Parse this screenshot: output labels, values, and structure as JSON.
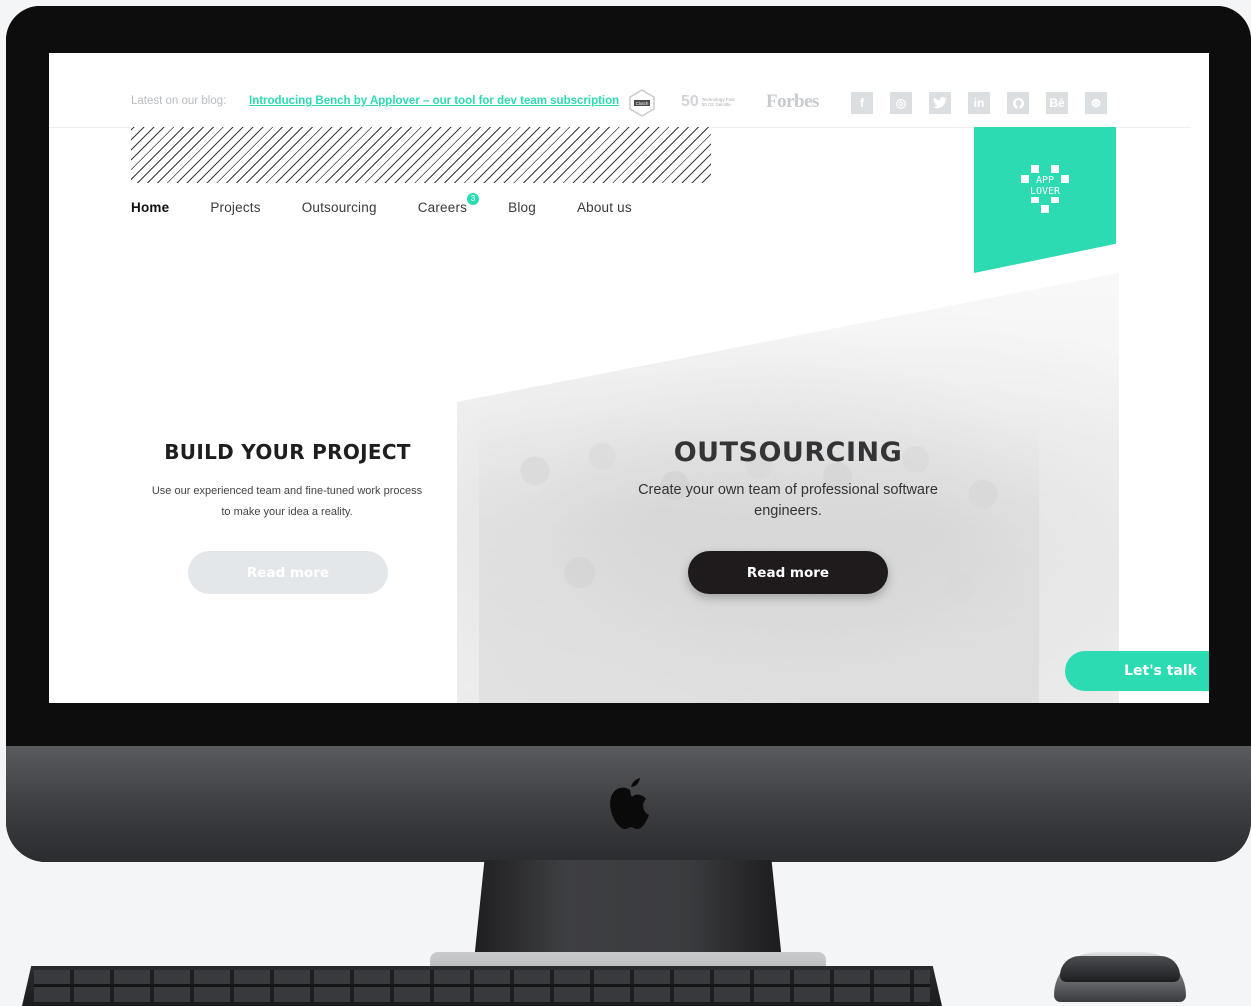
{
  "topbar": {
    "blog_label": "Latest on our blog:",
    "blog_link": "Introducing Bench by Applover – our tool for dev team subscription",
    "badges": {
      "clutch": "Clutch",
      "deloitte_number": "50",
      "deloitte_text": "Technology Fast 50 CE Deloitte",
      "forbes": "Forbes"
    },
    "socials": [
      {
        "icon": "facebook-icon",
        "glyph": "f"
      },
      {
        "icon": "instagram-icon",
        "glyph": "◎"
      },
      {
        "icon": "twitter-icon",
        "glyph": "🐦"
      },
      {
        "icon": "linkedin-icon",
        "glyph": "in"
      },
      {
        "icon": "github-icon",
        "glyph": "◉"
      },
      {
        "icon": "behance-icon",
        "glyph": "Bē"
      },
      {
        "icon": "dribbble-icon",
        "glyph": "⊛"
      }
    ]
  },
  "nav": {
    "items": [
      {
        "label": "Home",
        "active": true
      },
      {
        "label": "Projects"
      },
      {
        "label": "Outsourcing"
      },
      {
        "label": "Careers",
        "badge": "3"
      },
      {
        "label": "Blog"
      },
      {
        "label": "About us"
      }
    ]
  },
  "logo": {
    "lines": [
      "APP",
      "LOVER"
    ],
    "color": "#2ddbb3"
  },
  "hero": {
    "build": {
      "title": "BUILD YOUR PROJECT",
      "text": "Use our experienced team and fine-tuned work process to make your idea a reality.",
      "button": "Read more"
    },
    "outsourcing": {
      "title": "OUTSOURCING",
      "text": "Create your own team of professional software engineers.",
      "button": "Read more"
    }
  },
  "cta": {
    "label": "Let's talk"
  },
  "colors": {
    "accent": "#2ddbb3",
    "dark": "#1f1a1b"
  }
}
